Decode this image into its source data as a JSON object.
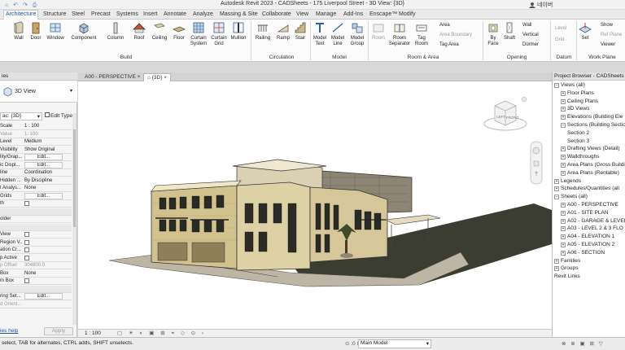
{
  "window": {
    "title": "Autodesk Revit 2023 - CADSheets - 175 Liverpool Street - 3D View: {3D}",
    "user": "네이버",
    "quick_access": "⌂ ↶ ↷ ⎙"
  },
  "ribbon_tabs": [
    "Architecture",
    "Structure",
    "Steel",
    "Precast",
    "Systems",
    "Insert",
    "Annotate",
    "Analyze",
    "Massing & Site",
    "Collaborate",
    "View",
    "Manage",
    "Add-Ins",
    "Enscape™",
    "Modify"
  ],
  "ribbon": {
    "build": {
      "label": "Build",
      "buttons": [
        "Wall",
        "Door",
        "Window",
        "Component",
        "Column",
        "Roof",
        "Ceiling",
        "Floor",
        "Curtain System",
        "Curtain Grid",
        "Mullion"
      ]
    },
    "circulation": {
      "label": "Circulation",
      "buttons": [
        "Railing",
        "Ramp",
        "Stair"
      ]
    },
    "model": {
      "label": "Model",
      "buttons": [
        "Model Text",
        "Model Line",
        "Model Group"
      ]
    },
    "room_area": {
      "label": "Room & Area",
      "buttons": [
        "Room",
        "Room Separator",
        "Tag Room"
      ],
      "small": [
        "Area",
        "Area Boundary",
        "Tag Area"
      ]
    },
    "opening": {
      "label": "Opening",
      "buttons": [
        "By Face",
        "Shaft"
      ],
      "small": [
        "Wall",
        "Vertical",
        "Dormer"
      ]
    },
    "datum": {
      "label": "Datum",
      "small": [
        "Level",
        "Grid"
      ]
    },
    "work_plane": {
      "label": "Work Plane",
      "buttons": [
        "Set"
      ],
      "small": [
        "Show",
        "Ref Plane",
        "Viewer"
      ]
    }
  },
  "properties": {
    "header": "ies",
    "type_name": "3D View",
    "selector": "ac: {3D}",
    "edit_type": "Edit Type",
    "rows": [
      {
        "k": "Scale",
        "v": "1 : 100"
      },
      {
        "k": "Value",
        "v": "1: 100",
        "dim": true
      },
      {
        "k": "Level",
        "v": "Medium"
      },
      {
        "k": "Visibility",
        "v": "Show Original"
      },
      {
        "k": "lity/Grap...",
        "v": "Edit...",
        "btn": true
      },
      {
        "k": "ic Displ...",
        "v": "Edit...",
        "btn": true
      },
      {
        "k": "line",
        "v": "Coordination"
      },
      {
        "k": "Hidden ...",
        "v": "By Discipline"
      },
      {
        "k": "t Analys...",
        "v": "None"
      },
      {
        "k": "Grids",
        "v": "Edit...",
        "btn": true
      },
      {
        "k": "th",
        "v": "",
        "check": true
      },
      {
        "k": "",
        "v": "",
        "section": true
      },
      {
        "k": "older",
        "v": ""
      },
      {
        "k": "",
        "v": "",
        "section": true
      },
      {
        "k": "View",
        "v": "",
        "check": true
      },
      {
        "k": "Region V...",
        "v": "",
        "check": true
      },
      {
        "k": "ation Cr...",
        "v": "",
        "check": true
      },
      {
        "k": "p Active",
        "v": "",
        "check": true
      },
      {
        "k": "p Offset",
        "v": "304800.0",
        "dim": true
      },
      {
        "k": "Box",
        "v": "None"
      },
      {
        "k": "m Box",
        "v": "",
        "check": true
      },
      {
        "k": "",
        "v": "",
        "section": true
      },
      {
        "k": "ring Set...",
        "v": "Edit...",
        "btn": true
      },
      {
        "k": "d Orient...",
        "v": "",
        "dim": true
      }
    ],
    "help_link": "ies help",
    "apply": "Apply"
  },
  "view_tabs": [
    {
      "label": "A00 - PERSPECTIVE",
      "active": false
    },
    {
      "label": "{3D}",
      "active": true
    }
  ],
  "viewcube": {
    "left": "LEFT",
    "front": "FRONT"
  },
  "view_control": {
    "scale": "1 : 100"
  },
  "browser": {
    "header": "Project Browser - CADSheets - 175",
    "items": [
      {
        "label": "Views (all)",
        "indent": 0,
        "toggle": "−"
      },
      {
        "label": "Floor Plans",
        "indent": 1,
        "toggle": "+"
      },
      {
        "label": "Ceiling Plans",
        "indent": 1,
        "toggle": "+"
      },
      {
        "label": "3D Views",
        "indent": 1,
        "toggle": "+"
      },
      {
        "label": "Elevations (Building Ele",
        "indent": 1,
        "toggle": "+"
      },
      {
        "label": "Sections (Building Sectio",
        "indent": 1,
        "toggle": "−"
      },
      {
        "label": "Section 2",
        "indent": 2,
        "toggle": ""
      },
      {
        "label": "Section 3",
        "indent": 2,
        "toggle": ""
      },
      {
        "label": "Drafting Views (Detail)",
        "indent": 1,
        "toggle": "+"
      },
      {
        "label": "Walkthroughs",
        "indent": 1,
        "toggle": "+"
      },
      {
        "label": "Area Plans (Gross Buildi",
        "indent": 1,
        "toggle": "+"
      },
      {
        "label": "Area Plans (Rentable)",
        "indent": 1,
        "toggle": "+"
      },
      {
        "label": "Legends",
        "indent": 0,
        "toggle": "+"
      },
      {
        "label": "Schedules/Quantities (all",
        "indent": 0,
        "toggle": "+"
      },
      {
        "label": "Sheets (all)",
        "indent": 0,
        "toggle": "−"
      },
      {
        "label": "A00 - PERSPECTIVE",
        "indent": 1,
        "toggle": "+"
      },
      {
        "label": "A01 - SITE PLAN",
        "indent": 1,
        "toggle": "+"
      },
      {
        "label": "A02 - GARAGE & LEVEL",
        "indent": 1,
        "toggle": "+"
      },
      {
        "label": "A03 - LEVEL 2 & 3 FLO",
        "indent": 1,
        "toggle": "+"
      },
      {
        "label": "A04 - ELEVATION 1",
        "indent": 1,
        "toggle": "+"
      },
      {
        "label": "A05 - ELEVATION 2",
        "indent": 1,
        "toggle": "+"
      },
      {
        "label": "A06 - SECTION",
        "indent": 1,
        "toggle": "+"
      },
      {
        "label": "Families",
        "indent": 0,
        "toggle": "+"
      },
      {
        "label": "Groups",
        "indent": 0,
        "toggle": "+"
      },
      {
        "label": "Revit Links",
        "indent": 0,
        "toggle": ""
      }
    ]
  },
  "status": {
    "hint": "select, TAB for alternates, CTRL adds, SHIFT unselects.",
    "model": "Main Model",
    "zero": ":0"
  },
  "colors": {
    "accent": "#1a55a5",
    "selection": "#cfe3fb",
    "ground": "#3b3d2e"
  }
}
